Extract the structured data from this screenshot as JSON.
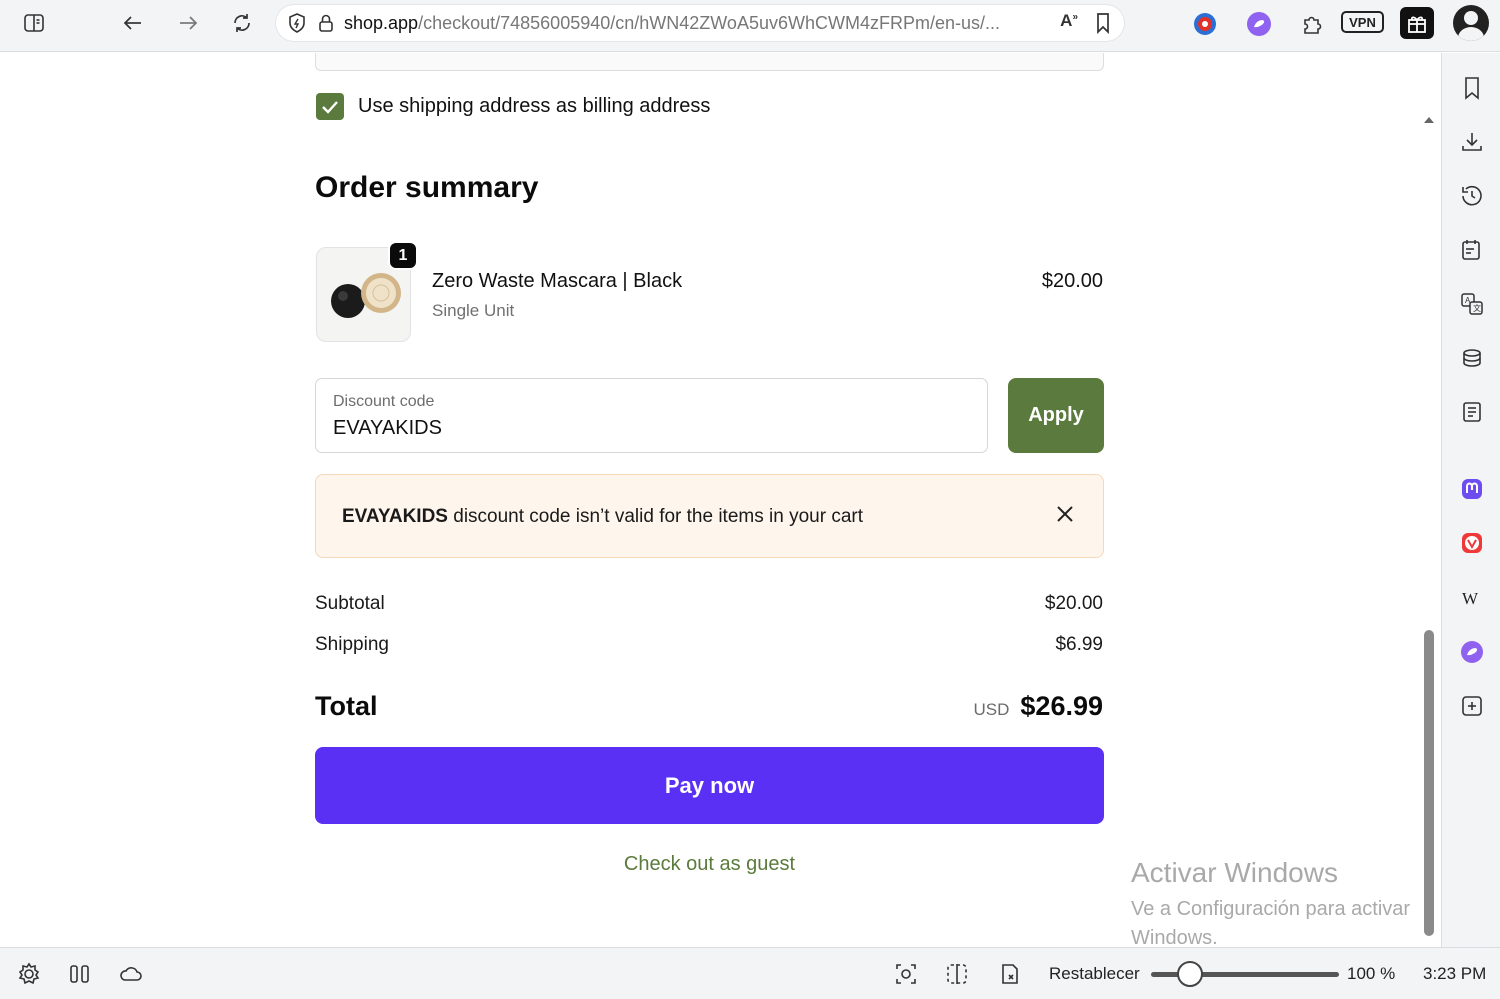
{
  "browser": {
    "url_host": "shop.app",
    "url_path": "/checkout/74856005940/cn/hWN42ZWoA5uv6WhCWM4zFRPm/en-us/...",
    "read_aloud": "A",
    "vpn_label": "VPN"
  },
  "checkout": {
    "billing_checkbox_label": "Use shipping address as billing address",
    "billing_checked": true,
    "order_summary_title": "Order summary",
    "product": {
      "quantity": "1",
      "name": "Zero Waste Mascara | Black",
      "variant": "Single Unit",
      "price": "$20.00"
    },
    "discount": {
      "label": "Discount code",
      "value": "EVAYAKIDS",
      "apply_label": "Apply"
    },
    "error": {
      "code": "EVAYAKIDS",
      "message": " discount code isn’t valid for the items in your cart"
    },
    "subtotal_label": "Subtotal",
    "subtotal_value": "$20.00",
    "shipping_label": "Shipping",
    "shipping_value": "$6.99",
    "total_label": "Total",
    "total_currency": "USD",
    "total_value": "$26.99",
    "pay_label": "Pay now",
    "guest_label": "Check out as guest"
  },
  "watermark": {
    "title": "Activar Windows",
    "subtitle": "Ve a Configuración para activar Windows."
  },
  "statusbar": {
    "reset_label": "Restablecer",
    "zoom": "100 %",
    "time": "3:23 PM"
  },
  "colors": {
    "accent_green": "#5b7a3d",
    "pay_purple": "#5a31f4",
    "error_bg": "#fef5ec"
  }
}
